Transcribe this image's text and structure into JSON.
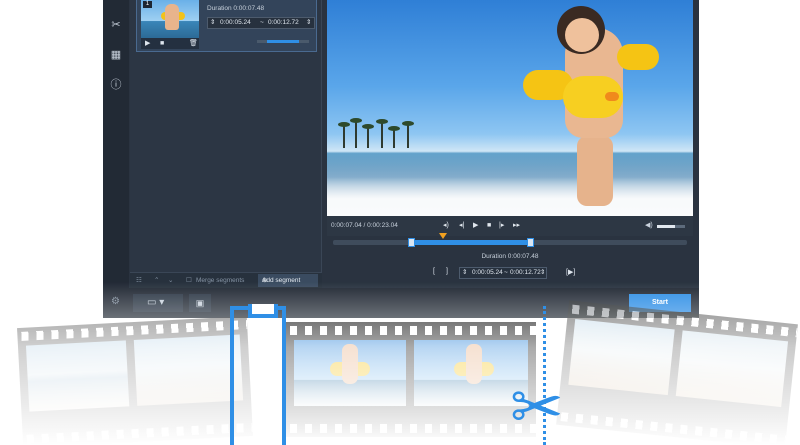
{
  "app": {
    "sidebar_icons": [
      "scissors-icon",
      "layers-icon",
      "info-icon"
    ],
    "segment": {
      "number": "1",
      "duration": "Duration 0:00:07.48",
      "start": "0:00:05.24",
      "separator": "~",
      "end": "0:00:12.72"
    },
    "panel_bottom": {
      "merge_label": "Merge segments",
      "add_segment_label": "Add segment"
    },
    "player": {
      "time": "0:00:07.04 / 0:00:23.04",
      "volume_fraction": 0.65
    },
    "timeline": {
      "selection_start_fraction": 0.22,
      "selection_end_fraction": 0.56,
      "marker_fraction": 0.31
    },
    "trim": {
      "duration": "Duration 0:00:07.48",
      "start": "0:00:05.24",
      "separator": "~",
      "end": "0:00:12.72"
    },
    "bottom": {
      "start_label": "Start"
    }
  },
  "colors": {
    "accent": "#2f8fe6",
    "window_bg": "#2a3340",
    "marker": "#f0a020"
  }
}
